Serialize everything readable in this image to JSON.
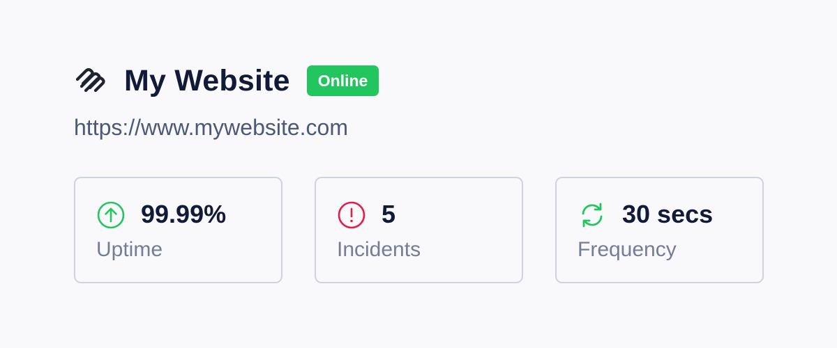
{
  "site": {
    "name": "My Website",
    "status": "Online",
    "url": "https://www.mywebsite.com",
    "logo_icon": "squarespace-logo-icon"
  },
  "stats": [
    {
      "value": "99.99%",
      "label": "Uptime",
      "icon": "arrow-up-circle-icon",
      "color": "#22c55e"
    },
    {
      "value": "5",
      "label": "Incidents",
      "icon": "alert-circle-icon",
      "color": "#e11d48"
    },
    {
      "value": "30 secs",
      "label": "Frequency",
      "icon": "refresh-icon",
      "color": "#22c55e"
    }
  ],
  "colors": {
    "background": "#f9f9fb",
    "title": "#111a36",
    "status_badge": "#22c55e",
    "url": "#4b5878",
    "label": "#737d96",
    "card_border": "#cfd3de"
  }
}
